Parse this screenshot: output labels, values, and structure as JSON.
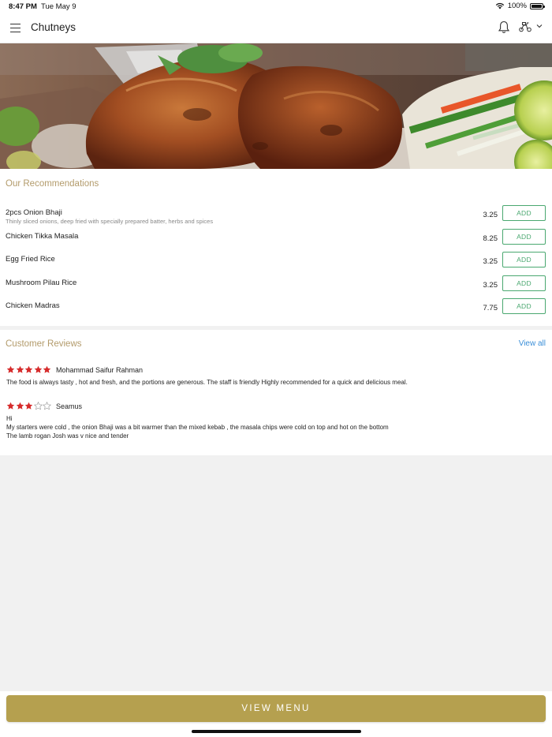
{
  "status_bar": {
    "time": "8:47 PM",
    "date": "Tue May 9",
    "battery": "100%"
  },
  "nav": {
    "title": "Chutneys",
    "icons": [
      "menu-icon",
      "bell-icon",
      "scooter-icon",
      "chevron-down-icon"
    ]
  },
  "hero": {
    "image": "grilled tandoori chicken with salad and lime"
  },
  "recommendations": {
    "title": "Our Recommendations",
    "items": [
      {
        "name": "2pcs Onion Bhaji",
        "description": "Thinly sliced onions, deep fried with specially prepared batter, herbs and spices",
        "price": "3.25",
        "button": "ADD"
      },
      {
        "name": "Chicken Tikka Masala",
        "description": "",
        "price": "8.25",
        "button": "ADD"
      },
      {
        "name": "Egg Fried Rice",
        "description": "",
        "price": "3.25",
        "button": "ADD"
      },
      {
        "name": "Mushroom Pilau Rice",
        "description": "",
        "price": "3.25",
        "button": "ADD"
      },
      {
        "name": "Chicken Madras",
        "description": "",
        "price": "7.75",
        "button": "ADD"
      }
    ]
  },
  "reviews": {
    "title": "Customer Reviews",
    "view_all": "View all",
    "star_color": "#d62b2b",
    "items": [
      {
        "name": "Mohammad Saifur Rahman",
        "rating": 5,
        "text": "The food is always tasty , hot and fresh, and the portions are generous. The staff is friendly Highly recommended for a quick and delicious meal."
      },
      {
        "name": "Seamus",
        "rating": 3,
        "text": "Hi\nMy starters were cold , the onion Bhaji was a bit warmer than the mixed kebab , the masala chips were cold on top and hot on the bottom\nThe lamb rogan Josh was v nice and tender"
      }
    ]
  },
  "footer": {
    "view_menu": "VIEW MENU",
    "button_color": "#b5a04f"
  }
}
